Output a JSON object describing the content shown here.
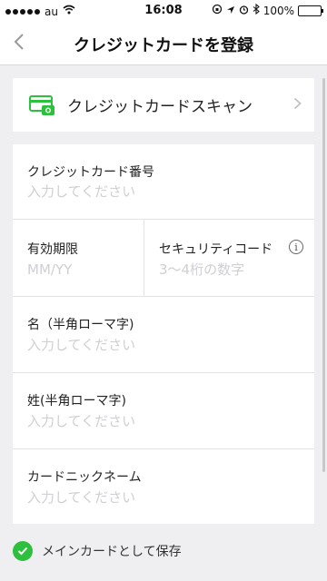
{
  "status_bar": {
    "carrier": "au",
    "time": "16:08",
    "battery": "100%"
  },
  "nav": {
    "title": "クレジットカードを登録"
  },
  "scan": {
    "label": "クレジットカードスキャン",
    "accent": "#2fbf3e"
  },
  "form": {
    "card_number": {
      "label": "クレジットカード番号",
      "placeholder": "入力してください"
    },
    "expiry": {
      "label": "有効期限",
      "placeholder": "MM/YY"
    },
    "security_code": {
      "label": "セキュリティコード",
      "placeholder": "3〜4桁の数字",
      "info": "i"
    },
    "first_name": {
      "label": "名（半角ローマ字)",
      "placeholder": "入力してください"
    },
    "last_name": {
      "label": "姓(半角ローマ字)",
      "placeholder": "入力してください"
    },
    "nickname": {
      "label": "カードニックネーム",
      "placeholder": "入力してください"
    }
  },
  "save_main": {
    "label": "メインカードとして保存",
    "checked": true
  }
}
